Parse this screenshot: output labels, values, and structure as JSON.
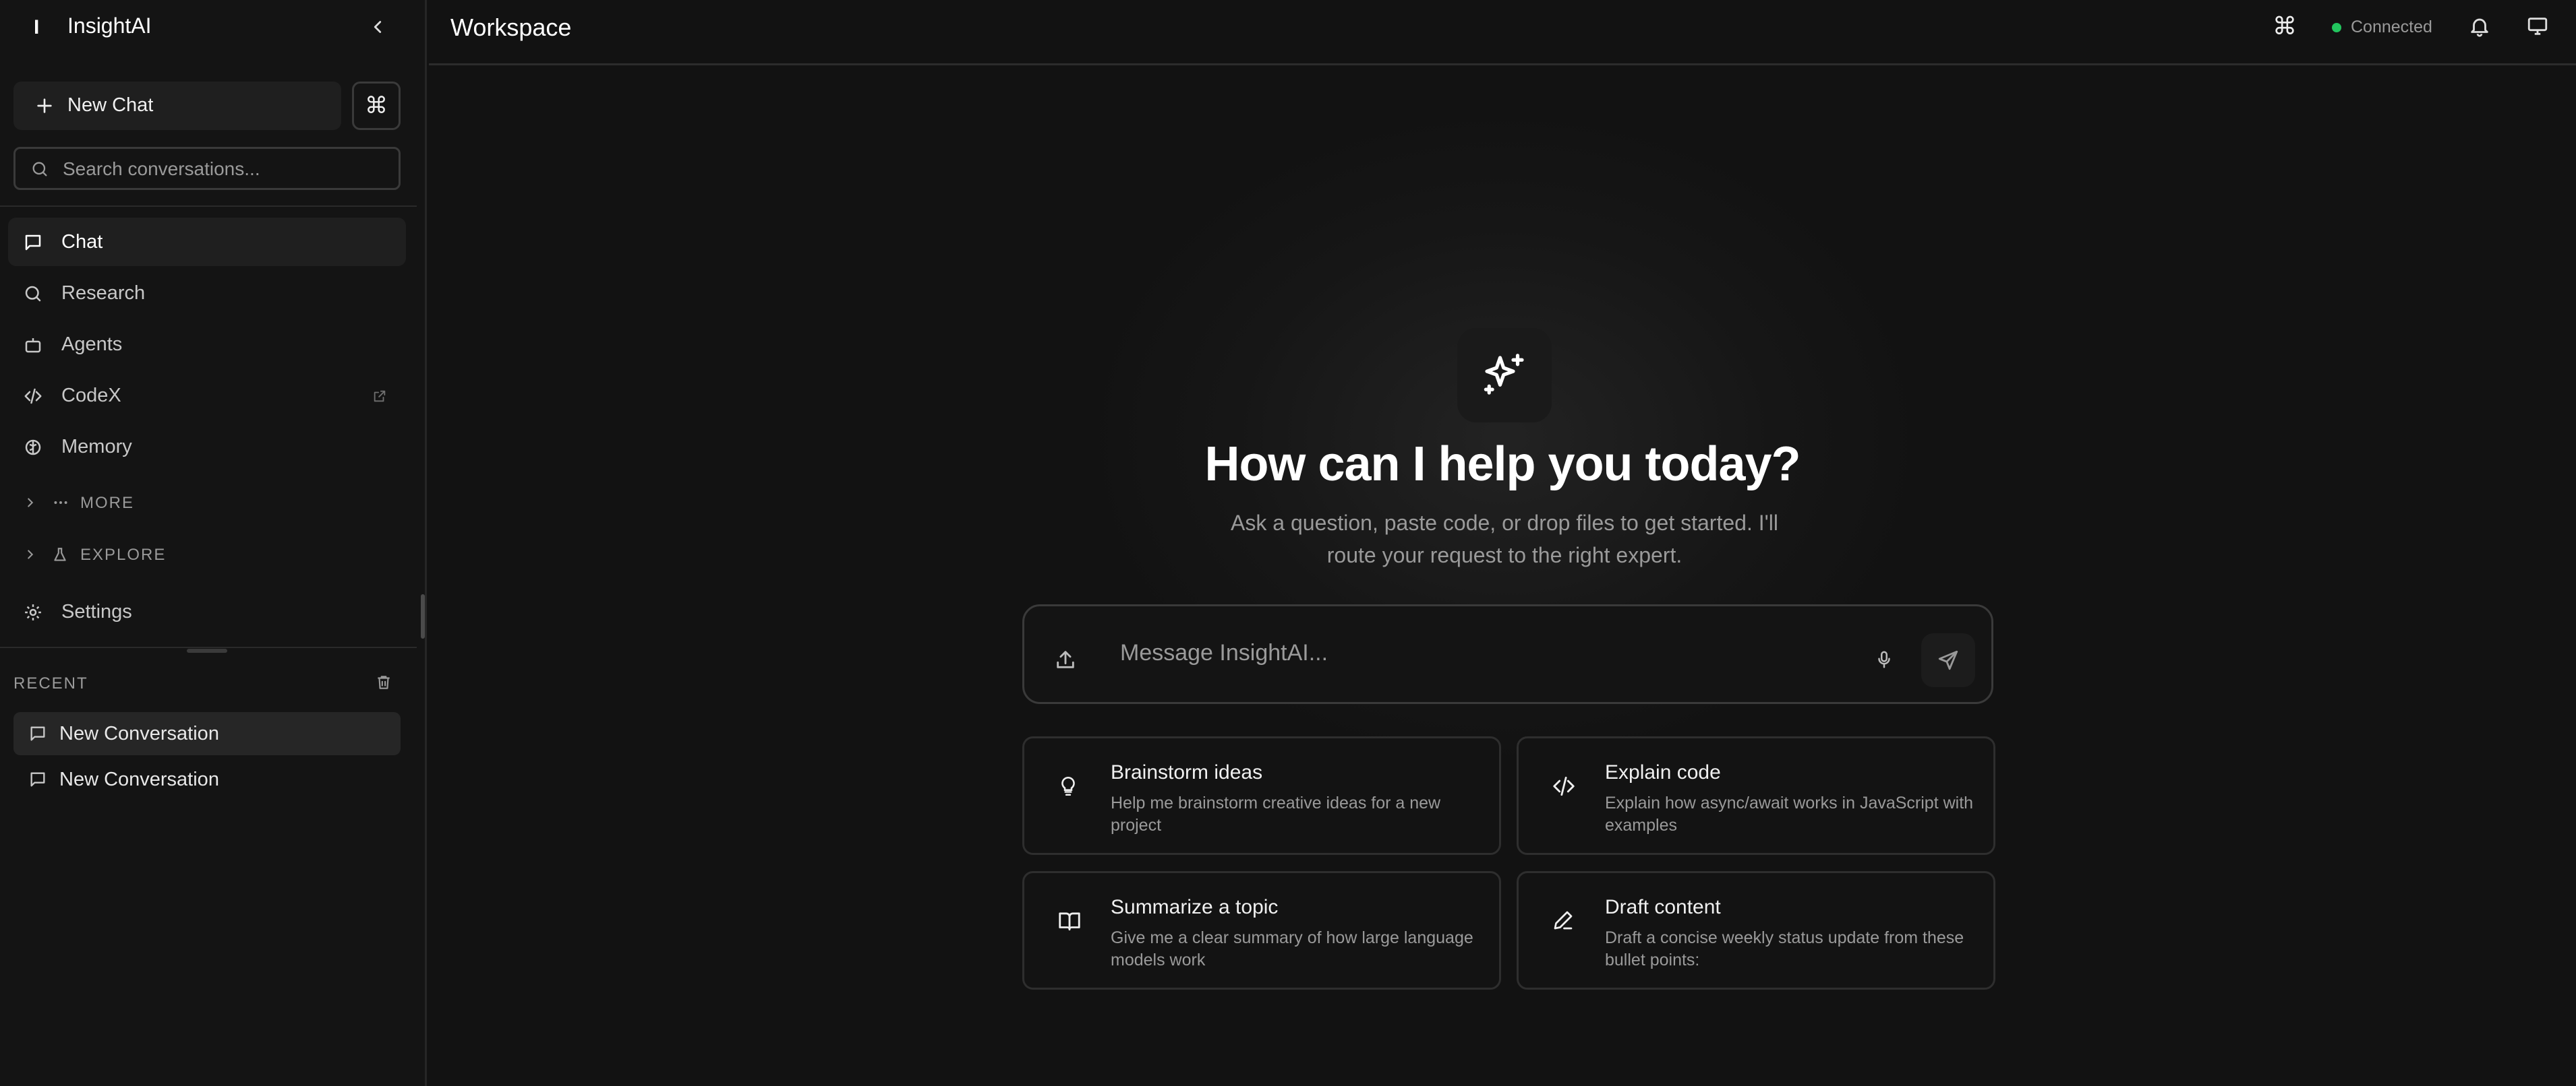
{
  "app": {
    "logo_letter": "I",
    "name": "InsightAI"
  },
  "sidebar": {
    "new_chat_label": "New Chat",
    "command_glyph": "⌘",
    "search_placeholder": "Search conversations...",
    "nav": [
      {
        "label": "Chat",
        "icon": "message-square-icon",
        "active": true
      },
      {
        "label": "Research",
        "icon": "search-icon",
        "active": false
      },
      {
        "label": "Agents",
        "icon": "bot-icon",
        "active": false
      },
      {
        "label": "CodeX",
        "icon": "code-icon",
        "active": false,
        "external": true
      },
      {
        "label": "Memory",
        "icon": "brain-icon",
        "active": false
      }
    ],
    "groups": [
      {
        "label": "MORE",
        "icon": "dots-icon"
      },
      {
        "label": "EXPLORE",
        "icon": "flask-icon"
      }
    ],
    "settings_label": "Settings",
    "recent_title": "RECENT",
    "recent": [
      {
        "label": "New Conversation",
        "active": true
      },
      {
        "label": "New Conversation",
        "active": false
      }
    ]
  },
  "header": {
    "title": "Workspace",
    "command_glyph": "⌘",
    "status": "Connected",
    "status_color": "#22c55e"
  },
  "main": {
    "heading": "How can I help you today?",
    "subtitle": "Ask a question, paste code, or drop files to get started. I'll route your request to the right expert.",
    "composer_placeholder": "Message InsightAI...",
    "suggestions": [
      {
        "title": "Brainstorm ideas",
        "desc": "Help me brainstorm creative ideas for a new project",
        "icon": "lightbulb-icon"
      },
      {
        "title": "Explain code",
        "desc": "Explain how async/await works in JavaScript with examples",
        "icon": "code-icon"
      },
      {
        "title": "Summarize a topic",
        "desc": "Give me a clear summary of how large language models work",
        "icon": "book-icon"
      },
      {
        "title": "Draft content",
        "desc": "Draft a concise weekly status update from these bullet points:",
        "icon": "pen-icon"
      }
    ]
  }
}
